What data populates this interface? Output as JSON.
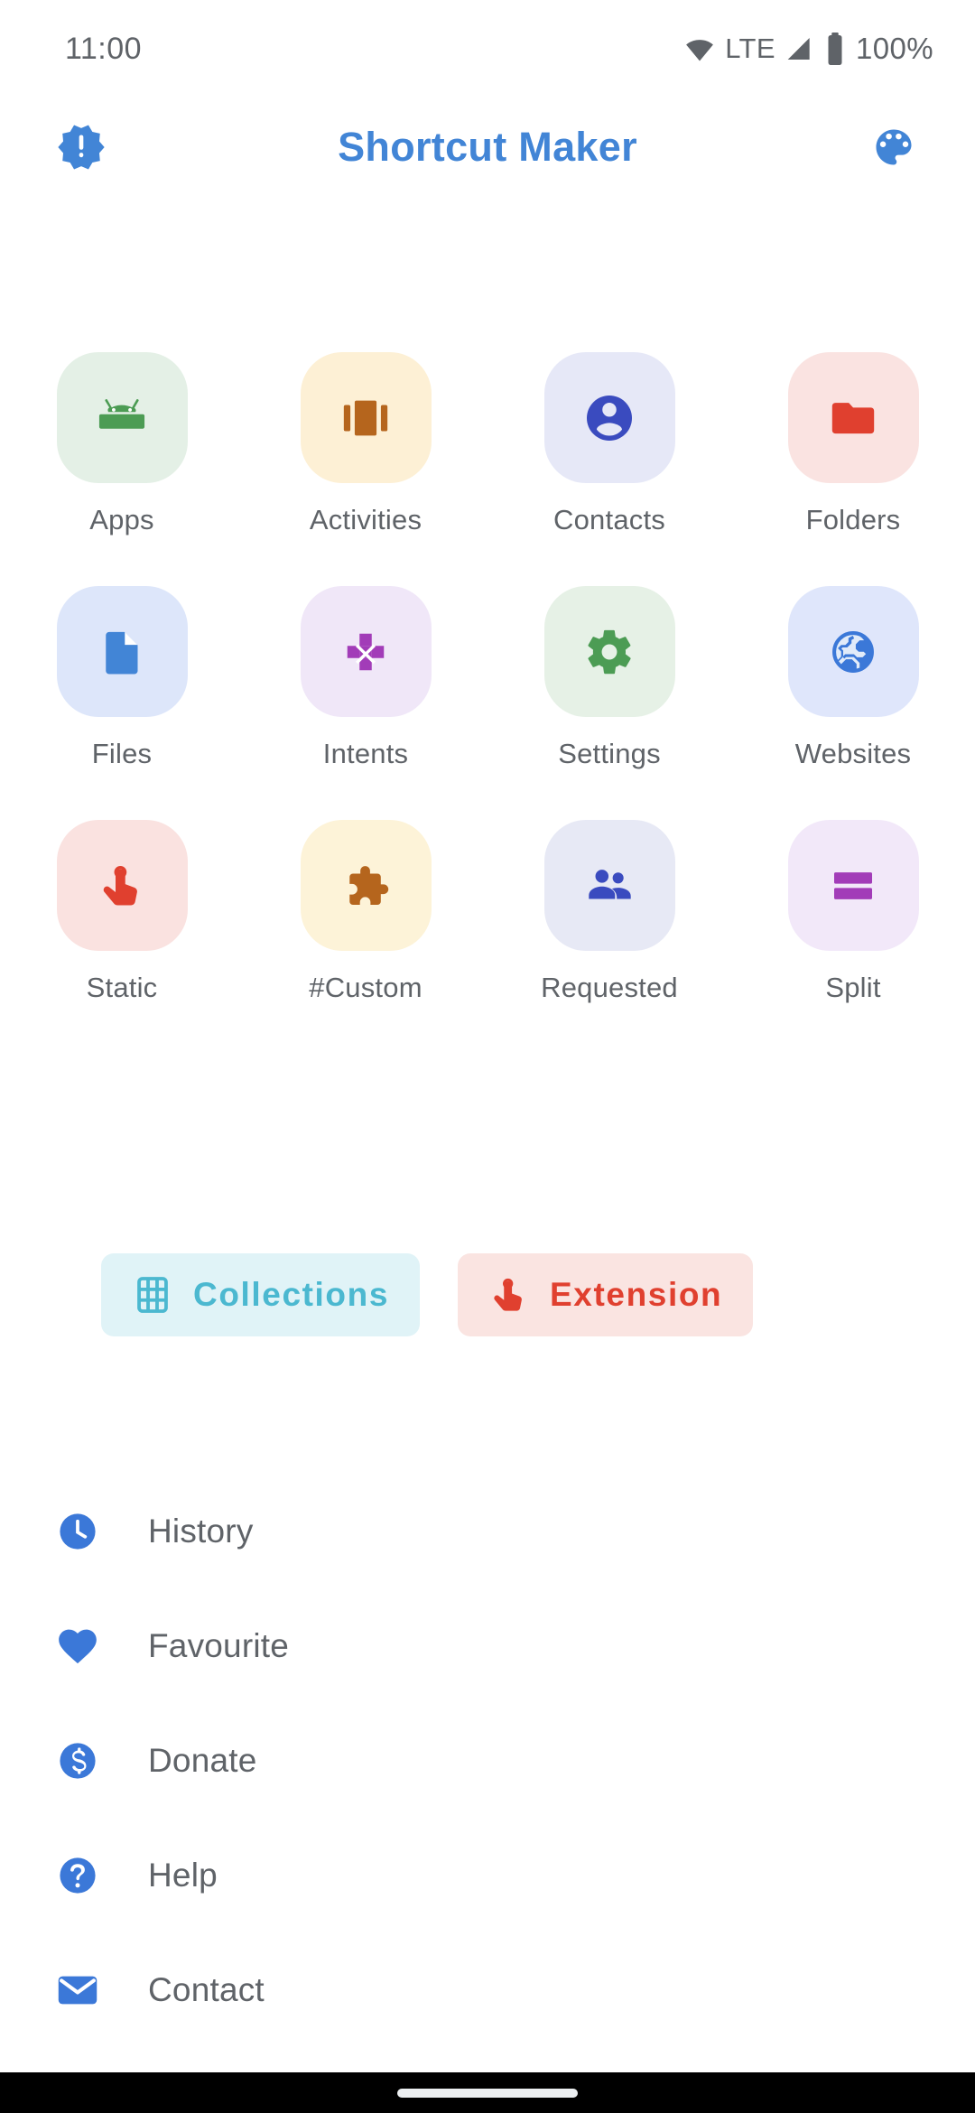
{
  "status_bar": {
    "time": "11:00",
    "network_label": "LTE",
    "battery_percent": "100%",
    "icons": [
      "wifi-icon",
      "signal-icon",
      "battery-icon"
    ]
  },
  "app_bar": {
    "title": "Shortcut Maker",
    "left_icon": "announcement-badge-icon",
    "right_icon": "palette-icon",
    "title_color": "#4285d6",
    "icon_color": "#4285d6"
  },
  "grid": {
    "items": [
      {
        "label": "Apps",
        "icon": "android-robot-icon",
        "tile_bg": "#e4f0e6",
        "icon_color": "#4c9c54"
      },
      {
        "label": "Activities",
        "icon": "view-carousel-icon",
        "tile_bg": "#fdf0d5",
        "icon_color": "#b5651d"
      },
      {
        "label": "Contacts",
        "icon": "account-circle-icon",
        "tile_bg": "#e6e8f7",
        "icon_color": "#3a4bbf"
      },
      {
        "label": "Folders",
        "icon": "folder-icon",
        "tile_bg": "#fae3e1",
        "icon_color": "#e0402f"
      },
      {
        "label": "Files",
        "icon": "document-icon",
        "tile_bg": "#dde6fa",
        "icon_color": "#4285d6"
      },
      {
        "label": "Intents",
        "icon": "four-arrows-icon",
        "tile_bg": "#f0e7f8",
        "icon_color": "#a23cb8"
      },
      {
        "label": "Settings",
        "icon": "gear-icon",
        "tile_bg": "#e6f1e6",
        "icon_color": "#4c9c54"
      },
      {
        "label": "Websites",
        "icon": "globe-icon",
        "tile_bg": "#dfe6fb",
        "icon_color": "#3b78d8"
      },
      {
        "label": "Static",
        "icon": "touch-finger-icon",
        "tile_bg": "#fae2e0",
        "icon_color": "#e0402f"
      },
      {
        "label": "#Custom",
        "icon": "puzzle-piece-icon",
        "tile_bg": "#fdf3d8",
        "icon_color": "#b5651d"
      },
      {
        "label": "Requested",
        "icon": "people-icon",
        "tile_bg": "#e7e9f5",
        "icon_color": "#3a4bbf"
      },
      {
        "label": "Split",
        "icon": "split-bars-icon",
        "tile_bg": "#f2e8f9",
        "icon_color": "#a23cb8"
      }
    ]
  },
  "actions": {
    "buttons": [
      {
        "label": "Collections",
        "icon": "grid-table-icon",
        "bg": "#e0f3f7",
        "fg": "#4bb8d0"
      },
      {
        "label": "Extension",
        "icon": "touch-finger-icon",
        "bg": "#fae4e1",
        "fg": "#e0402f"
      }
    ]
  },
  "menu": {
    "items": [
      {
        "label": "History",
        "icon": "clock-icon",
        "color": "#3b78d8"
      },
      {
        "label": "Favourite",
        "icon": "heart-icon",
        "color": "#3b78d8"
      },
      {
        "label": "Donate",
        "icon": "dollar-icon",
        "color": "#3b78d8"
      },
      {
        "label": "Help",
        "icon": "question-icon",
        "color": "#3b78d8"
      },
      {
        "label": "Contact",
        "icon": "envelope-icon",
        "color": "#3b78d8"
      }
    ]
  },
  "nav_bar": {
    "gesture_pill": "home-gesture-pill"
  }
}
